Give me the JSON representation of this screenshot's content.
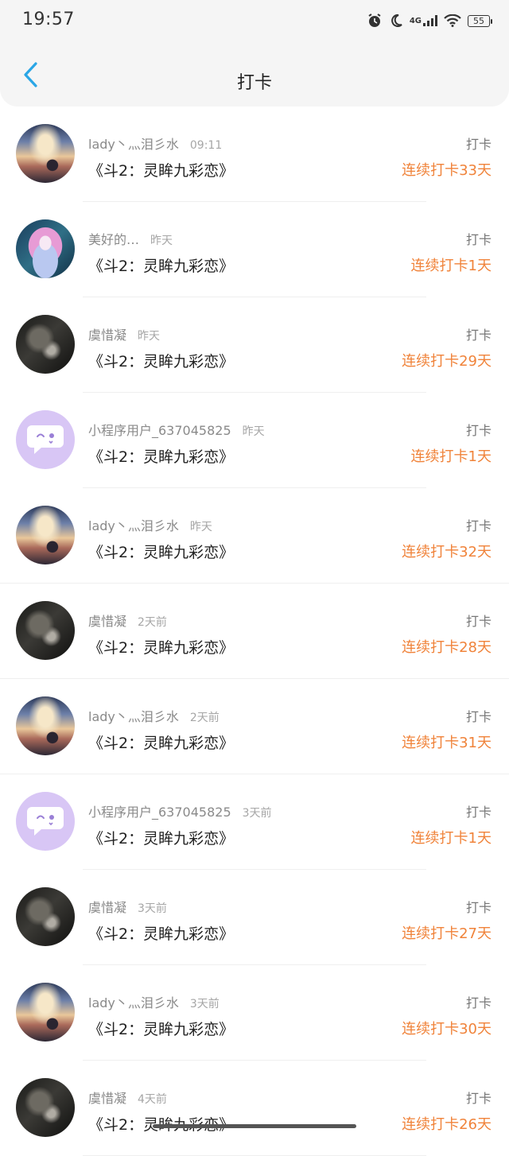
{
  "status_bar": {
    "time": "19:57",
    "network": "4G",
    "battery": "55"
  },
  "header": {
    "title": "打卡"
  },
  "colors": {
    "accent": "#f0833a",
    "back_arrow": "#2aa6e6",
    "bubble_avatar": "#d8c6f5"
  },
  "rows": [
    {
      "name": "lady丶灬泪彡水",
      "time": "09:11",
      "book": "《斗2：灵眸九彩恋》",
      "label": "打卡",
      "streak": "连续打卡33天",
      "avatar": "sky"
    },
    {
      "name": "美好的…",
      "time": "昨天",
      "book": "《斗2：灵眸九彩恋》",
      "label": "打卡",
      "streak": "连续打卡1天",
      "avatar": "anime"
    },
    {
      "name": "虞惜凝",
      "time": "昨天",
      "book": "《斗2：灵眸九彩恋》",
      "label": "打卡",
      "streak": "连续打卡29天",
      "avatar": "dark"
    },
    {
      "name": "小程序用户_637045825",
      "time": "昨天",
      "book": "《斗2：灵眸九彩恋》",
      "label": "打卡",
      "streak": "连续打卡1天",
      "avatar": "bubble"
    },
    {
      "name": "lady丶灬泪彡水",
      "time": "昨天",
      "book": "《斗2：灵眸九彩恋》",
      "label": "打卡",
      "streak": "连续打卡32天",
      "avatar": "sky"
    },
    {
      "name": "虞惜凝",
      "time": "2天前",
      "book": "《斗2：灵眸九彩恋》",
      "label": "打卡",
      "streak": "连续打卡28天",
      "avatar": "dark"
    },
    {
      "name": "lady丶灬泪彡水",
      "time": "2天前",
      "book": "《斗2：灵眸九彩恋》",
      "label": "打卡",
      "streak": "连续打卡31天",
      "avatar": "sky"
    },
    {
      "name": "小程序用户_637045825",
      "time": "3天前",
      "book": "《斗2：灵眸九彩恋》",
      "label": "打卡",
      "streak": "连续打卡1天",
      "avatar": "bubble"
    },
    {
      "name": "虞惜凝",
      "time": "3天前",
      "book": "《斗2：灵眸九彩恋》",
      "label": "打卡",
      "streak": "连续打卡27天",
      "avatar": "dark"
    },
    {
      "name": "lady丶灬泪彡水",
      "time": "3天前",
      "book": "《斗2：灵眸九彩恋》",
      "label": "打卡",
      "streak": "连续打卡30天",
      "avatar": "sky"
    },
    {
      "name": "虞惜凝",
      "time": "4天前",
      "book": "《斗2：灵眸九彩恋》",
      "label": "打卡",
      "streak": "连续打卡26天",
      "avatar": "dark"
    }
  ]
}
